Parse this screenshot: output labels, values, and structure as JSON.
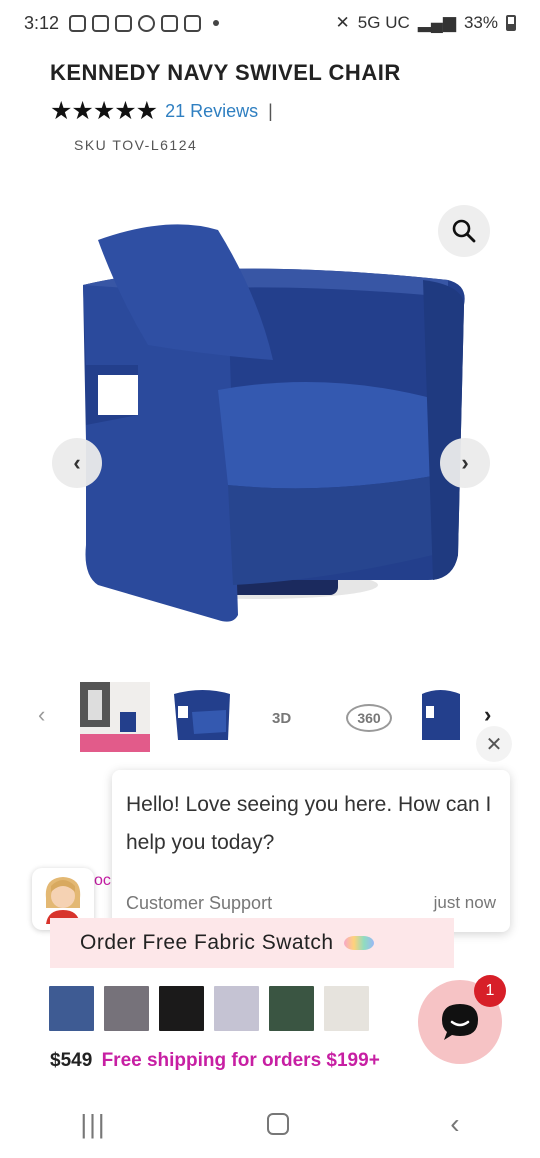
{
  "status_bar": {
    "time": "3:12",
    "network": "5G UC",
    "battery": "33%",
    "icons": [
      "instagram-icon",
      "instagram-icon",
      "instagram-icon",
      "account-icon",
      "key-icon",
      "lock-icon",
      "dot-icon"
    ]
  },
  "product": {
    "title": "KENNEDY NAVY SWIVEL CHAIR",
    "stars": "★★★★★",
    "reviews_label": "21 Reviews",
    "separator": "|",
    "sku": "SKU TOV-L6124"
  },
  "gallery": {
    "prev_arrow": "‹",
    "next_arrow": "›",
    "thumb_3d_label": "3D",
    "thumb_360_label": "360",
    "thumb_prev": "‹",
    "thumb_next": "›"
  },
  "chat": {
    "close": "✕",
    "message": "Hello! Love seeing you here. How can I help you today?",
    "sender": "Customer Support",
    "time": "just now",
    "partial_behind": "oc",
    "badge_count": "1"
  },
  "swatch_banner": {
    "label": "Order Free Fabric Swatch"
  },
  "swatches": [
    {
      "color": "#3e5b93"
    },
    {
      "color": "#76727a"
    },
    {
      "color": "#1b1a1a"
    },
    {
      "color": "#c5c3d3"
    },
    {
      "color": "#3a5542"
    },
    {
      "color": "#e6e3dd"
    }
  ],
  "pricing": {
    "price": "$549",
    "shipping": "Free shipping for orders $199+"
  },
  "nav": {
    "recents": "|||",
    "back": "‹"
  },
  "colors": {
    "accent_magenta": "#c71fa3",
    "link_blue": "#2f7fc1",
    "banner_pink": "#fde7e9",
    "chair_navy": "#233f8c"
  }
}
